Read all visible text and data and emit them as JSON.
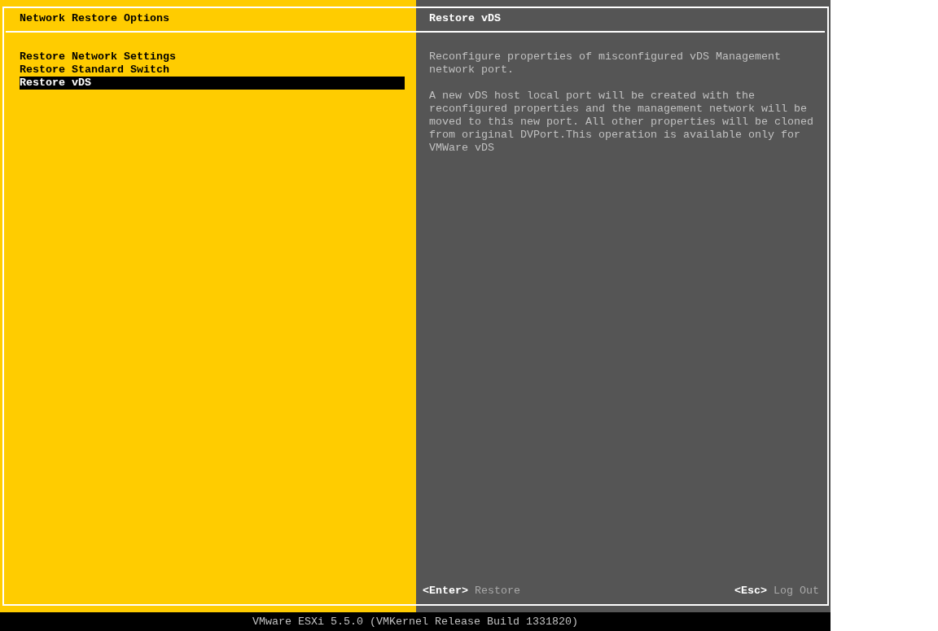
{
  "left_panel": {
    "title": "Network Restore Options",
    "items": [
      {
        "label": "Restore Network Settings",
        "selected": false
      },
      {
        "label": "Restore Standard Switch",
        "selected": false
      },
      {
        "label": "Restore vDS",
        "selected": true
      }
    ]
  },
  "right_panel": {
    "title": "Restore vDS",
    "paragraphs": [
      "Reconfigure properties of misconfigured vDS Management network port.",
      "A new vDS host local port will be created with the reconfigured properties and the management network will be moved to this new port. All other properties will be cloned from original DVPort.This operation is available only for VMWare vDS"
    ],
    "actions": [
      {
        "key": "<Enter>",
        "label": "Restore"
      },
      {
        "key": "<Esc>",
        "label": "Log Out"
      }
    ]
  },
  "status_bar": "VMware ESXi 5.5.0 (VMKernel Release Build 1331820)"
}
